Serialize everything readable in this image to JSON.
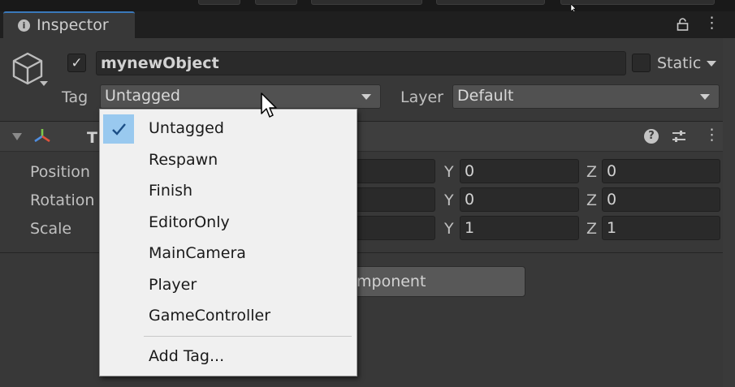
{
  "tab": {
    "title": "Inspector",
    "info_icon": "i"
  },
  "header": {
    "object_name": "mynewObject",
    "active_checked": true,
    "static_label": "Static",
    "tag_label": "Tag",
    "tag_value": "Untagged",
    "layer_label": "Layer",
    "layer_value": "Default"
  },
  "transform": {
    "title_letter": "T",
    "rows": [
      {
        "label": "Position",
        "y_axis": "Y",
        "y": "0",
        "z_axis": "Z",
        "z": "0"
      },
      {
        "label": "Rotation",
        "y_axis": "Y",
        "y": "0",
        "z_axis": "Z",
        "z": "0"
      },
      {
        "label": "Scale",
        "y_axis": "Y",
        "y": "1",
        "z_axis": "Z",
        "z": "1"
      }
    ]
  },
  "add_component_label": "mponent",
  "tag_menu": {
    "items": [
      {
        "label": "Untagged",
        "checked": true
      },
      {
        "label": "Respawn"
      },
      {
        "label": "Finish"
      },
      {
        "label": "EditorOnly"
      },
      {
        "label": "MainCamera"
      },
      {
        "label": "Player"
      },
      {
        "label": "GameController"
      }
    ],
    "add_tag_label": "Add Tag..."
  },
  "colors": {
    "accent": "#3a79bb",
    "menu_bg": "#f0f0f0",
    "check_highlight": "#99c9ef",
    "panel_bg": "#383838"
  }
}
